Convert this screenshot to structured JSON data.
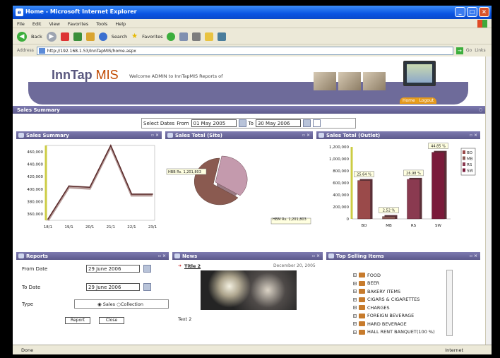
{
  "window": {
    "title": "Home - Microsoft Internet Explorer",
    "app_icon": "ie-icon"
  },
  "menu": [
    "File",
    "Edit",
    "View",
    "Favorites",
    "Tools",
    "Help"
  ],
  "toolbar": {
    "back": "Back",
    "search": "Search",
    "favorites": "Favorites"
  },
  "address": {
    "label": "Address",
    "url": "http://192.168.1.53/InnTapMIS/home.aspx",
    "go": "Go",
    "links": "Links"
  },
  "header": {
    "logo_main": "InnTap",
    "logo_mis": "MIS",
    "welcome": "Welcome ADMIN to InnTapMIS Reports of",
    "home": "Home",
    "logout": "Logout"
  },
  "sales_summary_bar": "Sales Summary",
  "dates": {
    "label": "Select Dates",
    "from_label": "From",
    "from": "01 May      2005",
    "to_label": "To",
    "to": "30 May      2006"
  },
  "panels": {
    "sales_summary": "Sales Summary",
    "sales_site": "Sales Total (Site)",
    "sales_outlet": "Sales Total (Outlet)",
    "reports": "Reports",
    "news": "News",
    "top_selling": "Top Selling Items"
  },
  "reports": {
    "from_label": "From Date",
    "from": "29 June      2006",
    "to_label": "To Date",
    "to": "29 June      2006",
    "type_label": "Type",
    "type_sales": "Sales",
    "type_collection": "Collection",
    "report_btn": "Report",
    "close_btn": "Close"
  },
  "news": {
    "title": "Title 2",
    "date": "December 20, 2005",
    "text": "Text 2"
  },
  "top_items": [
    "FOOD",
    "BEER",
    "BAKERY ITEMS",
    "CIGARS & CIGARETTES",
    "CHARGES",
    "FOREIGN BEVERAGE",
    "HARD BEVERAGE",
    "HALL RENT BANQUET(100 %)"
  ],
  "status": {
    "left": "Done",
    "right": "Internet"
  },
  "chart_data": [
    {
      "type": "line",
      "title": "Sales Summary",
      "x": [
        "18/1",
        "19/1",
        "20/1",
        "21/1",
        "22/1",
        "23/1"
      ],
      "values": [
        352000,
        405000,
        403000,
        470000,
        392000,
        392000
      ],
      "yticks": [
        360000,
        380000,
        400000,
        420000,
        440000,
        460000
      ],
      "ytick_labels": [
        "360,000",
        "380,000",
        "400,000",
        "420,000",
        "440,000",
        "460,000"
      ],
      "ylim": [
        350000,
        470000
      ],
      "color": "#5b2b2b"
    },
    {
      "type": "pie",
      "title": "Sales Total (Site)",
      "labels": [
        "HBM Rs. 1,201,803",
        "HBB Rs. 1,201,803"
      ],
      "values": [
        50,
        50
      ],
      "colors": [
        "#c49aad",
        "#8a5a50"
      ]
    },
    {
      "type": "bar",
      "title": "Sales Total (Outlet)",
      "categories": [
        "BO",
        "MB",
        "RS",
        "SW"
      ],
      "values": [
        640000,
        40000,
        660000,
        1110000
      ],
      "data_labels": [
        "25.64 %",
        "2.52 %",
        "26.98 %",
        "44.85 %"
      ],
      "yticks": [
        0,
        200000,
        400000,
        600000,
        800000,
        1000000,
        1200000
      ],
      "ytick_labels": [
        "0",
        "200,000",
        "400,000",
        "600,000",
        "800,000",
        "1,000,000",
        "1,200,000"
      ],
      "ylim": [
        0,
        1200000
      ],
      "legend": [
        "BO",
        "MB",
        "RS",
        "SW"
      ],
      "legend_position": "right",
      "colors": [
        "#9a4a4a",
        "#8a5a55",
        "#8a3a50",
        "#7a1a3a"
      ]
    }
  ]
}
